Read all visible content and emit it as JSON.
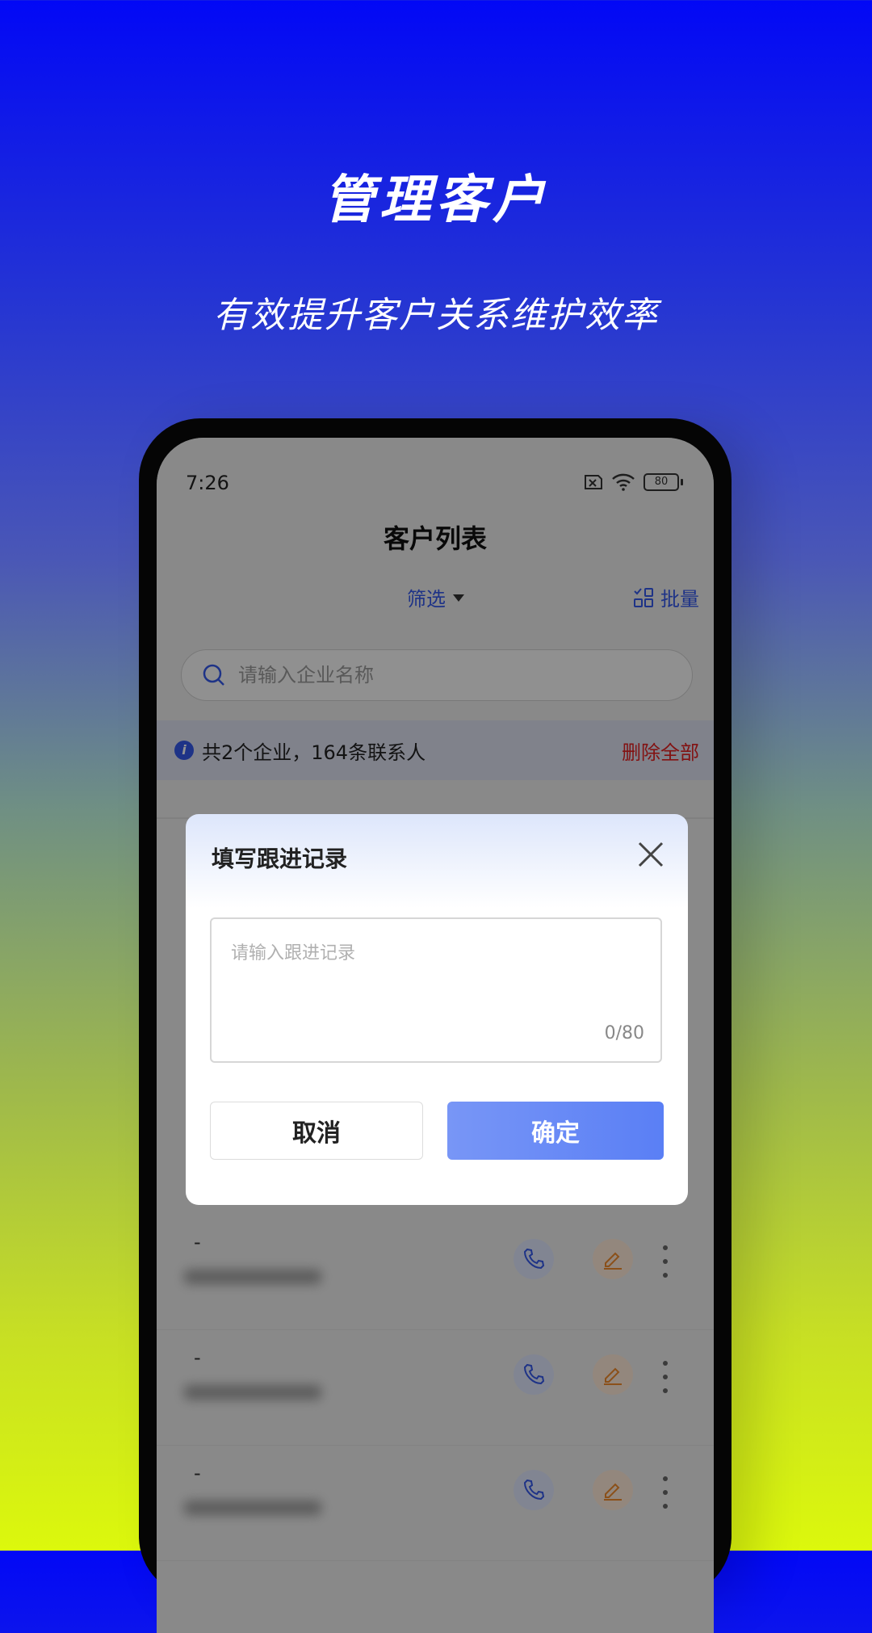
{
  "hero": {
    "title": "管理客户",
    "subtitle": "有效提升客户关系维护效率"
  },
  "status_bar": {
    "time": "7:26",
    "battery": "80",
    "icons": [
      "sim-off-icon",
      "wifi-icon",
      "battery-icon"
    ]
  },
  "header": {
    "title": "客户列表",
    "filter_label": "筛选",
    "batch_label": "批量"
  },
  "search": {
    "placeholder": "请输入企业名称",
    "value": ""
  },
  "info_bar": {
    "summary": "共2个企业，164条联系人",
    "delete_all_label": "删除全部"
  },
  "contacts": [
    {
      "name": "-"
    },
    {
      "name": "-"
    },
    {
      "name": "-"
    }
  ],
  "modal": {
    "title": "填写跟进记录",
    "textarea_placeholder": "请输入跟进记录",
    "textarea_value": "",
    "counter": "0/80",
    "cancel_label": "取消",
    "confirm_label": "确定"
  },
  "colors": {
    "accent": "#3558e8",
    "danger": "#e02020",
    "confirm_button": "#5a7ff5"
  }
}
